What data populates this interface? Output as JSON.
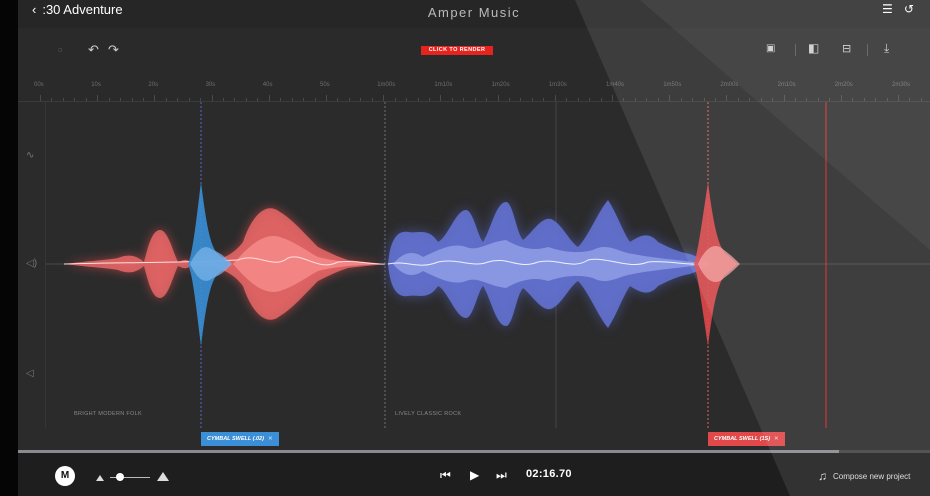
{
  "header": {
    "back_label": ":30 Adventure",
    "app_title": "Amper Music",
    "menu_icon": "menu-icon",
    "history_icon": "history-icon"
  },
  "toolbar": {
    "undo_icon": "undo-icon",
    "redo_icon": "redo-icon",
    "render_label": "CLICK TO RENDER",
    "fit_icon": "fit-icon",
    "layout_icon": "split-view-icon",
    "panel_icon": "panel-icon",
    "download_icon": "download-icon"
  },
  "timeline": {
    "ticks": [
      "00s",
      "10s",
      "20s",
      "30s",
      "40s",
      "50s",
      "1m00s",
      "1m10s",
      "1m20s",
      "1m30s",
      "1m40s",
      "1m50s",
      "2m00s",
      "2m10s",
      "2m20s",
      "2m30s"
    ]
  },
  "track": {
    "sections": [
      "BRIGHT MODERN FOLK",
      "LIVELY CLASSIC ROCK"
    ],
    "markers": [
      {
        "label": "CYMBAL SWELL (.02)",
        "color": "#3a8fd6"
      },
      {
        "label": "CYMBAL SWELL (1S)",
        "color": "#e0484a"
      }
    ]
  },
  "transport": {
    "mode_label": "M",
    "volume": 0.15,
    "progress": 0.9,
    "time": "02:16.70",
    "compose_label": "Compose new project"
  },
  "colors": {
    "accent_red": "#e5241f",
    "folk_wave": "#ef6b6b",
    "rock_wave": "#6a7ad8",
    "marker_blue": "#3a8fd6",
    "playhead": "#e5241f"
  }
}
